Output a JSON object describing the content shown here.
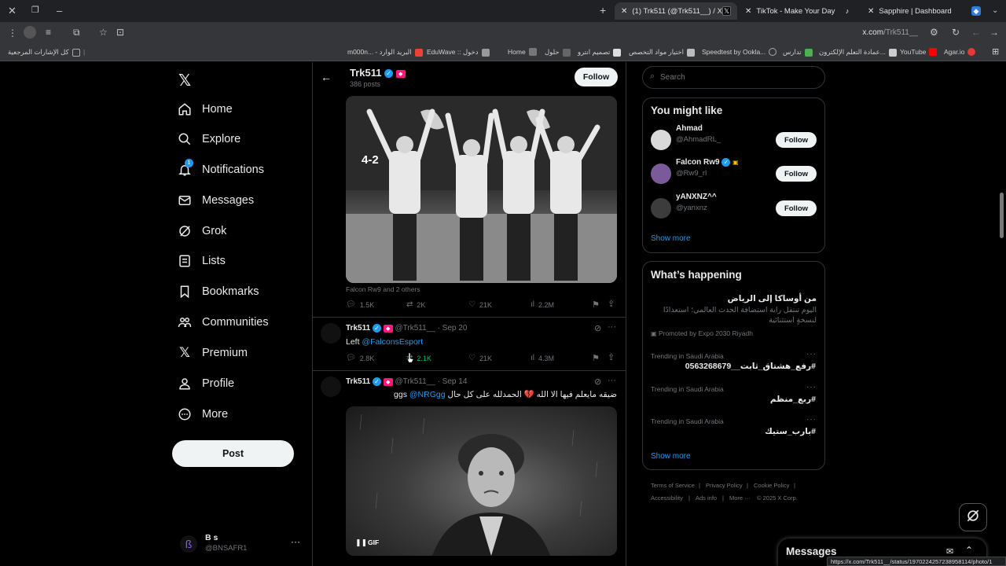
{
  "browser": {
    "tabs": [
      {
        "title": "(1) Trk511 (@Trk511__) / X",
        "active": true
      },
      {
        "title": "TikTok - Make Your Day",
        "active": false
      },
      {
        "title": "Sapphire | Dashboard",
        "active": false
      }
    ],
    "url_host": "x.com",
    "url_path": "/Trk511__",
    "bookmarks": [
      "كل الإشارات المرجعية",
      "m000n... - البريد الوارد",
      "EduWave :: دخول",
      "Home",
      "حلول",
      "تصميم انترو",
      "اختيار مواد التخصص",
      "Speedtest by Ookla...",
      "تدارس",
      "عمادة التعلم الإلكترون...",
      "YouTube",
      "Agar.io"
    ],
    "status_url": "https://x.com/Trk511__/status/1970224257238958114/photo/1"
  },
  "nav": {
    "items": [
      {
        "label": "Home",
        "icon": "home-icon"
      },
      {
        "label": "Explore",
        "icon": "search-icon"
      },
      {
        "label": "Notifications",
        "icon": "bell-icon",
        "badge": "1"
      },
      {
        "label": "Messages",
        "icon": "envelope-icon"
      },
      {
        "label": "Grok",
        "icon": "grok-icon"
      },
      {
        "label": "Lists",
        "icon": "lists-icon"
      },
      {
        "label": "Bookmarks",
        "icon": "bookmark-icon"
      },
      {
        "label": "Communities",
        "icon": "communities-icon"
      },
      {
        "label": "Premium",
        "icon": "x-logo-icon"
      },
      {
        "label": "Profile",
        "icon": "person-icon"
      },
      {
        "label": "More",
        "icon": "more-circle-icon"
      }
    ],
    "post_label": "Post",
    "account": {
      "name": "B s",
      "handle": "@BNSAFR1"
    }
  },
  "profile_header": {
    "name": "Trk511",
    "posts": "386 posts",
    "follow_label": "Follow"
  },
  "posts": [
    {
      "caption_small": "Falcon Rw9 and 2 others",
      "scoreboard": "4-2",
      "stats": {
        "replies": "1.5K",
        "reposts": "2K",
        "likes": "21K",
        "views": "2.2M"
      }
    },
    {
      "name": "Trk511",
      "handle": "@Trk511__",
      "date": "· Sep 20",
      "text_prefix": "Left ",
      "mention": "@FalconsEsport",
      "stats": {
        "replies": "2.8K",
        "reposts": "2.1K",
        "likes": "21K",
        "views": "4.3M"
      }
    },
    {
      "name": "Trk511",
      "handle": "@Trk511__",
      "date": "· Sep 14",
      "text": "ضيقه مايعلم فيها الا الله 💔 الحمدلله على كل حال ggs",
      "mention": "@NRGgg",
      "gif_label": "GIF"
    }
  ],
  "search": {
    "placeholder": "Search"
  },
  "you_might_like": {
    "title": "You might like",
    "users": [
      {
        "name": "Ahmad",
        "handle": "@AhmadRL_",
        "follow": "Follow"
      },
      {
        "name": "Falcon Rw9",
        "handle": "@Rw9_rl",
        "follow": "Follow"
      },
      {
        "name": "yANXNZ^^",
        "handle": "@yanxnz",
        "follow": "Follow"
      }
    ],
    "show_more": "Show more"
  },
  "whats_happening": {
    "title": "What’s happening",
    "promo": {
      "title": "من أوساكا إلى الرياض",
      "body": "اليوم تنتقل راية استضافة الحدث العالمي؛ استعدادًا لنسخةٍ استثنائية",
      "promoted": "Promoted by Expo 2030 Riyadh"
    },
    "trends": [
      {
        "category": "Trending in Saudi Arabia",
        "tag": "#رفع_هشتاق_ثابت__0563268679"
      },
      {
        "category": "Trending in Saudi Arabia",
        "tag": "#ربع_منظم"
      },
      {
        "category": "Trending in Saudi Arabia",
        "tag": "#بارب_ستيك"
      }
    ],
    "show_more": "Show more"
  },
  "footer": {
    "links": [
      "Terms of Service",
      "Privacy Policy",
      "Cookie Policy",
      "Accessibility",
      "Ads info",
      "More ···",
      "© 2025 X Corp."
    ]
  },
  "messages_drawer": {
    "title": "Messages"
  }
}
